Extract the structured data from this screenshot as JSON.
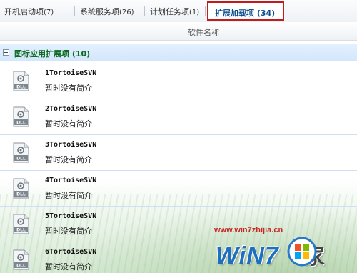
{
  "tabs": [
    {
      "label": "开机启动项",
      "count": "(7)"
    },
    {
      "label": "系统服务项",
      "count": "(26)"
    },
    {
      "label": "计划任务项",
      "count": "(1)"
    }
  ],
  "active_tab": {
    "label": "扩展加载项 (34)"
  },
  "column_header": "软件名称",
  "group": {
    "title": "图标应用扩展项 (10)"
  },
  "items": [
    {
      "name": "1TortoiseSVN",
      "desc": "暂时没有简介",
      "icon_label": "DLL"
    },
    {
      "name": "2TortoiseSVN",
      "desc": "暂时没有简介",
      "icon_label": "DLL"
    },
    {
      "name": "3TortoiseSVN",
      "desc": "暂时没有简介",
      "icon_label": "DLL"
    },
    {
      "name": "4TortoiseSVN",
      "desc": "暂时没有简介",
      "icon_label": "DLL"
    },
    {
      "name": "5TortoiseSVN",
      "desc": "暂时没有简介",
      "icon_label": "DLL"
    },
    {
      "name": "6TortoiseSVN",
      "desc": "暂时没有简介",
      "icon_label": "DLL"
    }
  ],
  "watermark": {
    "url": "www.win7zhijia.cn",
    "brand": "WiN7",
    "suffix": "家"
  },
  "colors": {
    "active_tab_border": "#c21b1b",
    "group_title": "#0b6b1f",
    "active_tab_text": "#0b4d8c"
  }
}
